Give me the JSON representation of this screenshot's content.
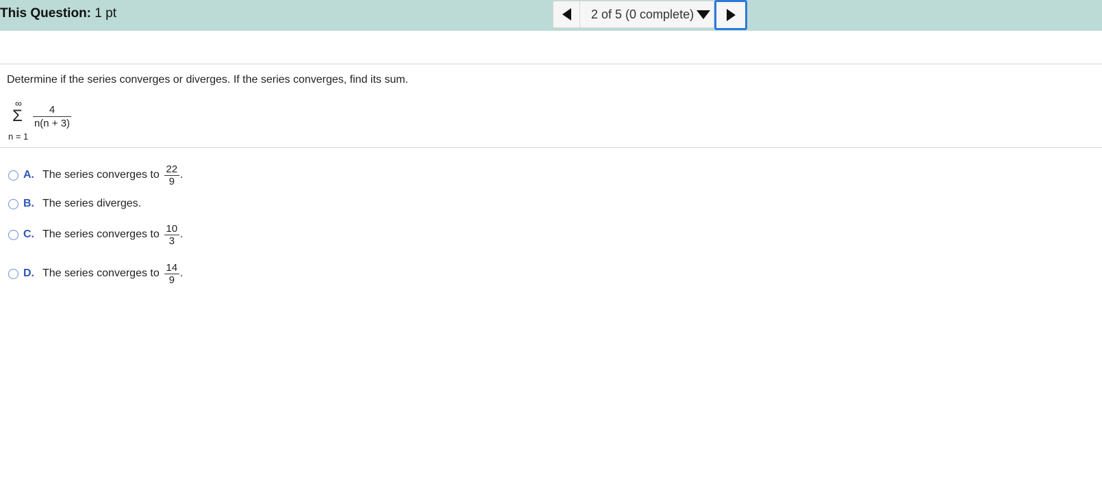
{
  "header": {
    "question_label": "This Question:",
    "question_points": "1 pt",
    "nav_status": "2 of 5 (0 complete)"
  },
  "question": {
    "prompt": "Determine if the series converges or diverges. If the series converges, find its sum.",
    "series": {
      "sigma": "Σ",
      "upper": "∞",
      "lower": "n = 1",
      "numerator": "4",
      "denominator": "n(n + 3)"
    }
  },
  "options": [
    {
      "letter": "A.",
      "text": "The series converges to",
      "num": "22",
      "den": "9",
      "end": "."
    },
    {
      "letter": "B.",
      "text": "The series diverges."
    },
    {
      "letter": "C.",
      "text": "The series converges to",
      "num": "10",
      "den": "3",
      "end": "."
    },
    {
      "letter": "D.",
      "text": "The series converges to",
      "num": "14",
      "den": "9",
      "end": "."
    }
  ],
  "colors": {
    "header_bg": "#bcdad6",
    "focus_border": "#2a7ad8",
    "option_letter": "#3056b8",
    "radio_border": "#6b8fd6"
  }
}
